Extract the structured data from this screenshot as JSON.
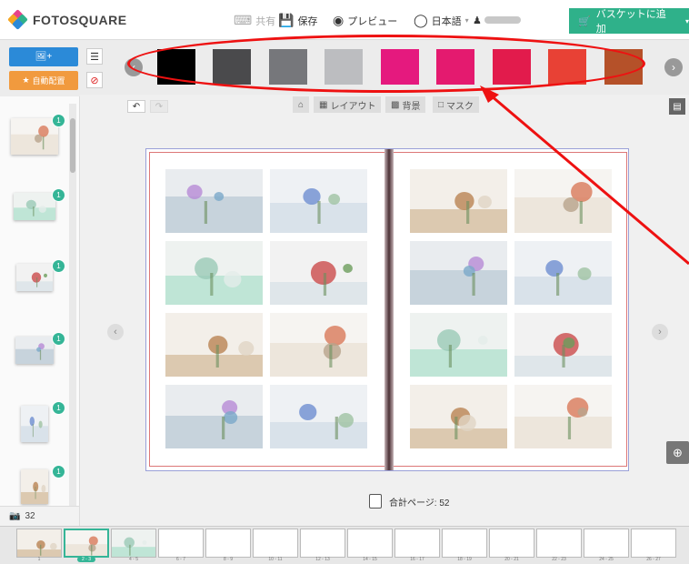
{
  "app": {
    "logo_text": "FOTOSQUARE"
  },
  "header": {
    "share": "共有",
    "save": "保存",
    "preview": "プレビュー",
    "language": "日本語",
    "cart": "バスケットに追加"
  },
  "tools": {
    "auto_layout": "自動配置"
  },
  "toolbar": {
    "layout": "レイアウト",
    "background": "背景",
    "mask": "マスク"
  },
  "colors": [
    "#000000",
    "#4a4a4c",
    "#76777b",
    "#bcbdc0",
    "#e5197e",
    "#e41a6f",
    "#e21b4c",
    "#e84135",
    "#b55129"
  ],
  "sidebar": {
    "photo_count": "32",
    "thumbs": [
      {
        "badge": "1"
      },
      {
        "badge": "1"
      },
      {
        "badge": "1"
      },
      {
        "badge": "1"
      },
      {
        "badge": "1"
      },
      {
        "badge": "1"
      }
    ]
  },
  "spread": {
    "total_label": "合計ページ: 52"
  },
  "bottom_pages": [
    {
      "label": "1"
    },
    {
      "label": "2 - 3"
    },
    {
      "label": "4 - 5"
    },
    {
      "label": "6 - 7"
    },
    {
      "label": "8 - 9"
    },
    {
      "label": "10 - 11"
    },
    {
      "label": "12 - 13"
    },
    {
      "label": "14 - 15"
    },
    {
      "label": "16 - 17"
    },
    {
      "label": "18 - 19"
    },
    {
      "label": "20 - 21"
    },
    {
      "label": "22 - 23"
    },
    {
      "label": "24 - 25"
    },
    {
      "label": "26 - 27"
    }
  ]
}
